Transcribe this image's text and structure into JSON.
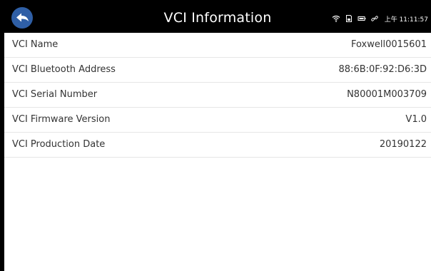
{
  "header": {
    "title": "VCI Information",
    "back_icon": "back-arrow-icon",
    "status_icons": [
      "wifi-icon",
      "sd-card-icon",
      "battery-icon",
      "link-icon"
    ],
    "time": "上午 11:11:57"
  },
  "rows": [
    {
      "label": "VCI Name",
      "value": "Foxwell0015601"
    },
    {
      "label": "VCI Bluetooth Address",
      "value": "88:6B:0F:92:D6:3D"
    },
    {
      "label": "VCI Serial Number",
      "value": "N80001M003709"
    },
    {
      "label": "VCI Firmware Version",
      "value": "V1.0"
    },
    {
      "label": "VCI Production Date",
      "value": "20190122"
    }
  ],
  "colors": {
    "frame": "#000000",
    "header_bg": "#000000",
    "back_button_bg": "#2f5fa6",
    "content_bg": "#ffffff",
    "divider": "#e6e6e6",
    "text": "#333333"
  }
}
